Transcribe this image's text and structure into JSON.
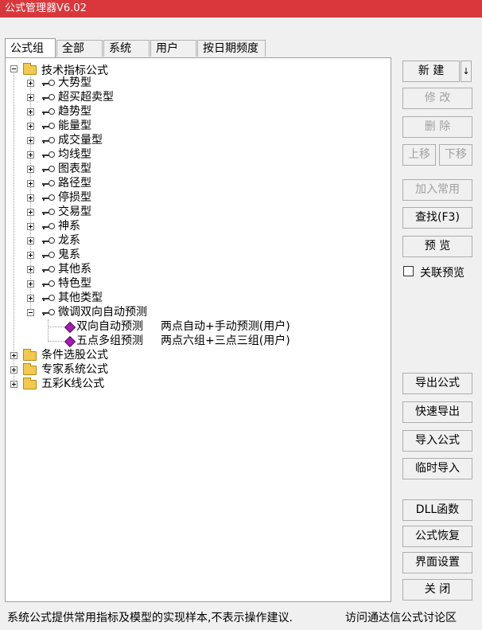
{
  "window": {
    "title": "公式管理器V6.02"
  },
  "tabs": [
    {
      "label": "公式组",
      "active": true
    },
    {
      "label": "全部"
    },
    {
      "label": "系统"
    },
    {
      "label": "用户"
    },
    {
      "label": "按日期频度"
    }
  ],
  "tree": {
    "root": {
      "label": "技术指标公式",
      "icon": "folder-icon"
    },
    "categories": [
      "大势型",
      "超买超卖型",
      "趋势型",
      "能量型",
      "成交量型",
      "均线型",
      "图表型",
      "路径型",
      "停损型",
      "交易型",
      "神系",
      "龙系",
      "鬼系",
      "其他系",
      "特色型",
      "其他类型"
    ],
    "expanded_category": "微调双向自动预测",
    "formulas": [
      {
        "name": "双向自动预测",
        "desc": "两点自动+手动预测(用户)"
      },
      {
        "name": "五点多组预测",
        "desc": "两点六组+三点三组(用户)"
      }
    ],
    "other_roots": [
      "条件选股公式",
      "专家系统公式",
      "五彩K线公式"
    ]
  },
  "buttons": {
    "new": "新  建",
    "new_arrow": "↓",
    "modify": "修  改",
    "delete": "删  除",
    "move_up": "上移",
    "move_down": "下移",
    "add_common": "加入常用",
    "find": "查找(F3)",
    "preview": "预  览",
    "export": "导出公式",
    "quick_export": "快速导出",
    "import": "导入公式",
    "temp_import": "临时导入",
    "dll": "DLL函数",
    "restore": "公式恢复",
    "ui_settings": "界面设置",
    "close": "关  闭"
  },
  "link_preview": {
    "label": "关联预览",
    "checked": false
  },
  "status": {
    "left": "系统公式提供常用指标及模型的实现样本,不表示操作建议.",
    "right": "访问通达信公式讨论区"
  },
  "colors": {
    "titlebar": "#d9373c",
    "formula_icon": "#a020b0"
  }
}
